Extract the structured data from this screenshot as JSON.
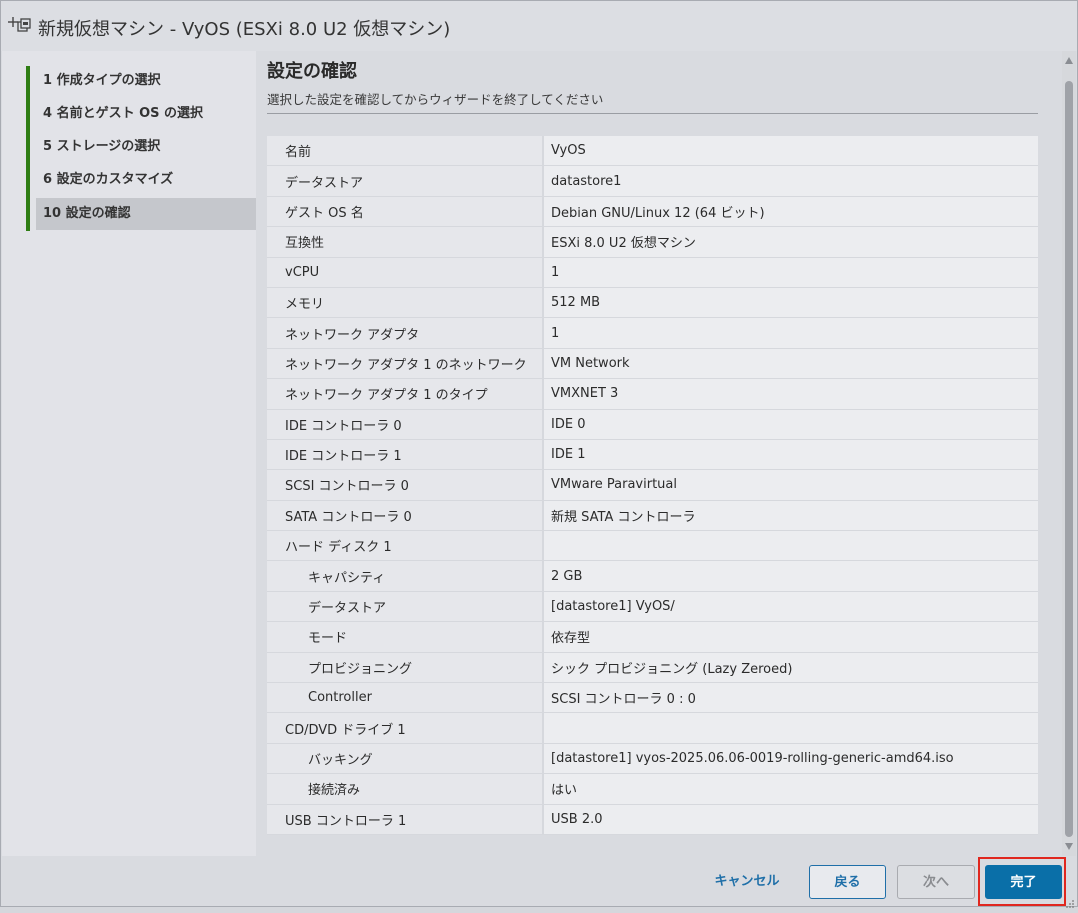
{
  "window": {
    "title": "新規仮想マシン - VyOS (ESXi 8.0 U2 仮想マシン)"
  },
  "sidebar": {
    "steps": [
      {
        "label": "1   作成タイプの選択"
      },
      {
        "label": "4   名前とゲスト OS の選択"
      },
      {
        "label": "5   ストレージの選択"
      },
      {
        "label": "6   設定のカスタマイズ"
      },
      {
        "label": "10   設定の確認"
      }
    ],
    "active_index": 4,
    "accent_color": "#2f7d14"
  },
  "main": {
    "heading": "設定の確認",
    "subheading": "選択した設定を確認してからウィザードを終了してください",
    "rows": [
      {
        "key": "名前",
        "value": "VyOS"
      },
      {
        "key": "データストア",
        "value": "datastore1"
      },
      {
        "key": "ゲスト OS 名",
        "value": "Debian GNU/Linux 12 (64 ビット)"
      },
      {
        "key": "互換性",
        "value": "ESXi 8.0 U2 仮想マシン"
      },
      {
        "key": "vCPU",
        "value": "1"
      },
      {
        "key": "メモリ",
        "value": "512 MB"
      },
      {
        "key": "ネットワーク アダプタ",
        "value": "1"
      },
      {
        "key": "ネットワーク アダプタ 1 のネットワーク",
        "value": "VM Network"
      },
      {
        "key": "ネットワーク アダプタ 1 のタイプ",
        "value": "VMXNET 3"
      },
      {
        "key": "IDE コントローラ 0",
        "value": "IDE 0"
      },
      {
        "key": "IDE コントローラ 1",
        "value": "IDE 1"
      },
      {
        "key": "SCSI コントローラ 0",
        "value": "VMware Paravirtual"
      },
      {
        "key": "SATA コントローラ 0",
        "value": "新規 SATA コントローラ"
      },
      {
        "key": "ハード ディスク 1",
        "value": ""
      },
      {
        "key": "キャパシティ",
        "value": "2 GB",
        "sub": true
      },
      {
        "key": "データストア",
        "value": "[datastore1] VyOS/",
        "sub": true
      },
      {
        "key": "モード",
        "value": "依存型",
        "sub": true
      },
      {
        "key": "プロビジョニング",
        "value": "シック プロビジョニング (Lazy Zeroed)",
        "sub": true
      },
      {
        "key": "Controller",
        "value": "SCSI コントローラ 0 : 0",
        "sub": true
      },
      {
        "key": "CD/DVD ドライブ 1",
        "value": ""
      },
      {
        "key": "バッキング",
        "value": "[datastore1] vyos-2025.06.06-0019-rolling-generic-amd64.iso",
        "sub": true
      },
      {
        "key": "接続済み",
        "value": "はい",
        "sub": true
      },
      {
        "key": "USB コントローラ 1",
        "value": "USB 2.0"
      }
    ]
  },
  "footer": {
    "cancel_label": "キャンセル",
    "back_label": "戻る",
    "next_label": "次へ",
    "finish_label": "完了"
  },
  "colors": {
    "primary_button": "#0a6fa8",
    "link": "#1f6fa8",
    "highlight_box": "#e0271f"
  },
  "icons": {
    "title_icon": "new-vm-icon"
  }
}
